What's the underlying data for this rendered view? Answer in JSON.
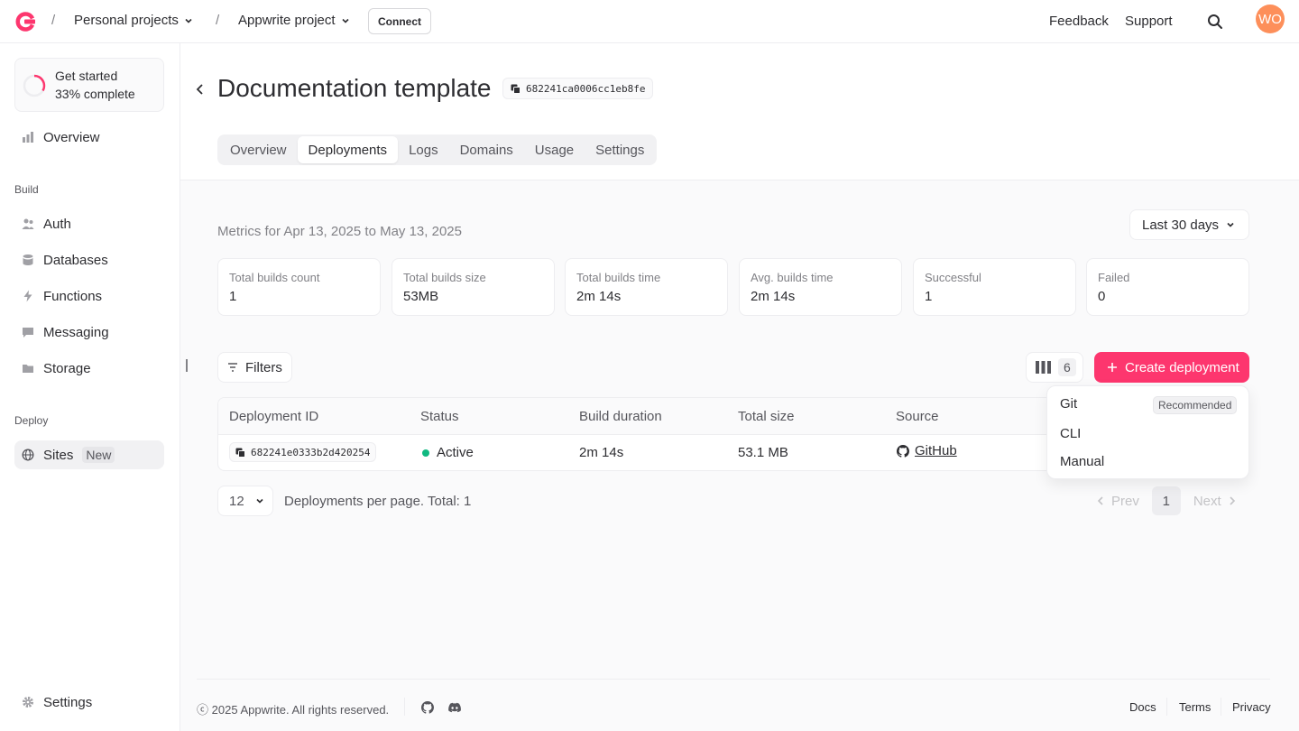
{
  "header": {
    "breadcrumbs": [
      {
        "label": "Personal projects"
      },
      {
        "label": "Appwrite project"
      }
    ],
    "connect_label": "Connect",
    "feedback_label": "Feedback",
    "support_label": "Support",
    "avatar_initials": "WO"
  },
  "sidebar": {
    "get_started": {
      "title": "Get started",
      "progress_text": "33% complete",
      "progress": 0.33
    },
    "overview_label": "Overview",
    "build_section": "Build",
    "build_items": [
      {
        "label": "Auth",
        "icon": "users-icon"
      },
      {
        "label": "Databases",
        "icon": "database-icon"
      },
      {
        "label": "Functions",
        "icon": "lightning-icon"
      },
      {
        "label": "Messaging",
        "icon": "chat-icon"
      },
      {
        "label": "Storage",
        "icon": "folder-icon"
      }
    ],
    "deploy_section": "Deploy",
    "sites_label": "Sites",
    "sites_badge": "New",
    "settings_label": "Settings"
  },
  "page": {
    "title": "Documentation template",
    "id": "682241ca0006cc1eb8fe",
    "tabs": [
      {
        "label": "Overview",
        "active": false
      },
      {
        "label": "Deployments",
        "active": true
      },
      {
        "label": "Logs",
        "active": false
      },
      {
        "label": "Domains",
        "active": false
      },
      {
        "label": "Usage",
        "active": false
      },
      {
        "label": "Settings",
        "active": false
      }
    ]
  },
  "metrics": {
    "label": "Metrics for Apr 13, 2025 to May 13, 2025",
    "range": "Last 30 days",
    "cards": [
      {
        "label": "Total builds count",
        "value": "1"
      },
      {
        "label": "Total builds size",
        "value": "53MB"
      },
      {
        "label": "Total builds time",
        "value": "2m 14s"
      },
      {
        "label": "Avg. builds time",
        "value": "2m 14s"
      },
      {
        "label": "Successful",
        "value": "1"
      },
      {
        "label": "Failed",
        "value": "0"
      }
    ]
  },
  "toolbar": {
    "filters_label": "Filters",
    "columns_count": "6",
    "create_label": "Create deployment"
  },
  "table": {
    "headers": [
      "Deployment ID",
      "Status",
      "Build duration",
      "Total size",
      "Source"
    ],
    "rows": [
      {
        "id": "682241e0333b2d420254",
        "status": "Active",
        "duration": "2m 14s",
        "size": "53.1 MB",
        "source": "GitHub"
      }
    ]
  },
  "pagination": {
    "per_page": "12",
    "per_page_text": "Deployments per page. Total: 1",
    "prev": "Prev",
    "page": "1",
    "next": "Next"
  },
  "dropdown": {
    "items": [
      {
        "label": "Git",
        "badge": "Recommended"
      },
      {
        "label": "CLI"
      },
      {
        "label": "Manual"
      }
    ]
  },
  "footer": {
    "copyright": "2025 Appwrite. All rights reserved.",
    "links": [
      "Docs",
      "Terms",
      "Privacy"
    ]
  },
  "colors": {
    "accent": "#fd366e",
    "active_status": "#10b981",
    "avatar": "#fd8f5a"
  }
}
